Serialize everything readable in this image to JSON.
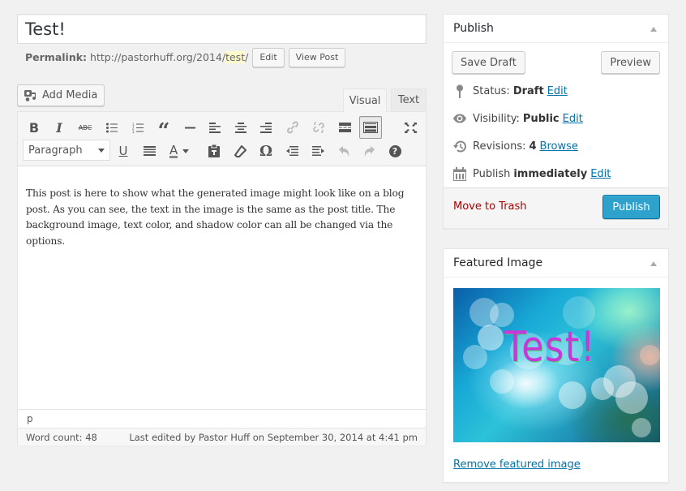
{
  "post": {
    "title": "Test!",
    "permalink_label": "Permalink:",
    "permalink_base": "http://pastorhuff.org/2014/",
    "permalink_slug": "test",
    "permalink_end": "/",
    "edit_label": "Edit",
    "view_post_label": "View Post"
  },
  "editor": {
    "add_media_label": "Add Media",
    "tabs": [
      {
        "label": "Visual",
        "active": true
      },
      {
        "label": "Text",
        "active": false
      }
    ],
    "toolbar_row1": [
      {
        "name": "bold",
        "glyph": "B"
      },
      {
        "name": "italic",
        "glyph": "I"
      },
      {
        "name": "strikethrough",
        "glyph": "ABC"
      },
      {
        "name": "bulleted-list"
      },
      {
        "name": "numbered-list"
      },
      {
        "name": "blockquote",
        "glyph": "“"
      },
      {
        "name": "horizontal-line"
      },
      {
        "name": "align-left"
      },
      {
        "name": "align-center"
      },
      {
        "name": "align-right"
      },
      {
        "name": "insert-link",
        "disabled": true
      },
      {
        "name": "remove-link",
        "disabled": true
      },
      {
        "name": "insert-read-more"
      },
      {
        "name": "toolbar-toggle",
        "active": true
      },
      {
        "name": "distraction-free"
      }
    ],
    "toolbar_row2": [
      {
        "name": "underline",
        "glyph": "U"
      },
      {
        "name": "justify"
      },
      {
        "name": "text-color",
        "glyph": "A"
      },
      {
        "name": "paste-as-text"
      },
      {
        "name": "clear-formatting"
      },
      {
        "name": "special-character",
        "glyph": "Ω"
      },
      {
        "name": "decrease-indent"
      },
      {
        "name": "increase-indent"
      },
      {
        "name": "undo",
        "disabled": true
      },
      {
        "name": "redo",
        "disabled": true
      },
      {
        "name": "keyboard-shortcuts",
        "glyph": "?"
      }
    ],
    "format_select": "Paragraph",
    "content": "This post is here to show what the generated image might look like on a blog post. As you can see, the text in the image is the same as the post title. The background image, text color, and shadow color can all be changed via the options.",
    "path": "p",
    "word_count": "Word count: 48",
    "last_edited": "Last edited by Pastor Huff on September 30, 2014 at 4:41 pm"
  },
  "publish_box": {
    "title": "Publish",
    "save_draft_label": "Save Draft",
    "preview_label": "Preview",
    "status_label": "Status:",
    "status_value": "Draft",
    "status_edit": "Edit",
    "visibility_label": "Visibility:",
    "visibility_value": "Public",
    "visibility_edit": "Edit",
    "revisions_label": "Revisions:",
    "revisions_value": "4",
    "revisions_browse": "Browse",
    "publish_label": "Publish",
    "publish_value": "immediately",
    "publish_edit": "Edit",
    "trash_label": "Move to Trash",
    "publish_button": "Publish",
    "colors": {
      "primary": "#2ea2cc",
      "trash": "#aa0000",
      "link": "#0073aa"
    }
  },
  "featured_box": {
    "title": "Featured Image",
    "image_text": "Test!",
    "remove_label": "Remove featured image",
    "colors": {
      "text": "#c936d9",
      "shadow": "#3fd96a"
    }
  }
}
